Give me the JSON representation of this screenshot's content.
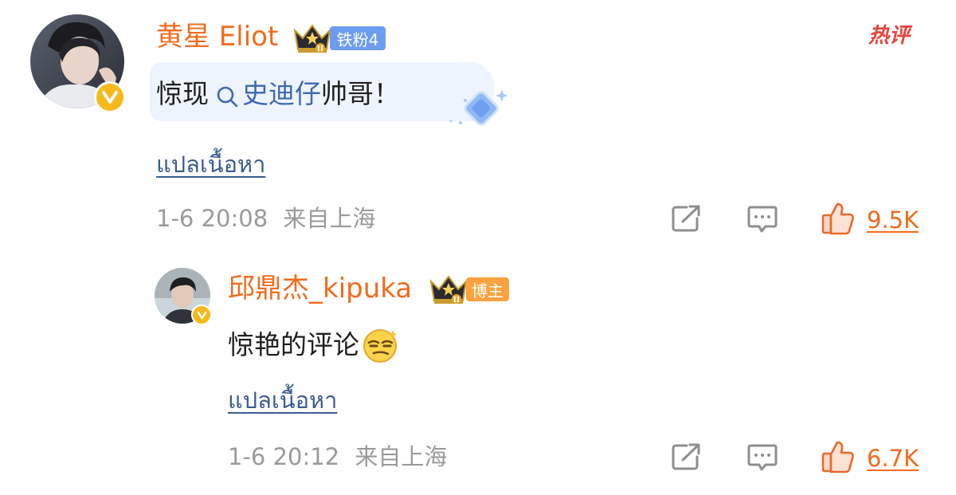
{
  "hot_badge": "热评",
  "comments": [
    {
      "username": "黄星 Eliot",
      "fan_tag": "铁粉4",
      "text_prefix": "惊现",
      "keyword": "史迪仔",
      "text_suffix": "帅哥！",
      "translate": "แปลเนื้อหา",
      "timestamp": "1-6 20:08",
      "location": "来自上海",
      "likes": "9.5K"
    },
    {
      "username": "邱鼎杰_kipuka",
      "fan_tag": "博主",
      "text": "惊艳的评论",
      "translate": "แปลเนื้อหา",
      "timestamp": "1-6 20:12",
      "location": "来自上海",
      "likes": "6.7K"
    }
  ],
  "icons": {
    "share": "share-icon",
    "reply": "comment-icon",
    "like": "thumbs-up-icon",
    "search": "search-icon",
    "verified": "verified-v-icon",
    "medal": "crown-medal-icon",
    "emoji": "smug-face-emoji",
    "sticker": "diamond-sticker"
  },
  "colors": {
    "username": "#f26b1d",
    "like": "#f26b1d",
    "fan_tag": "#6c9cf0",
    "owner_tag": "#f9a33e",
    "translate": "#3a5c8f",
    "meta": "#9a9a9a",
    "hot": "#e6423c"
  }
}
